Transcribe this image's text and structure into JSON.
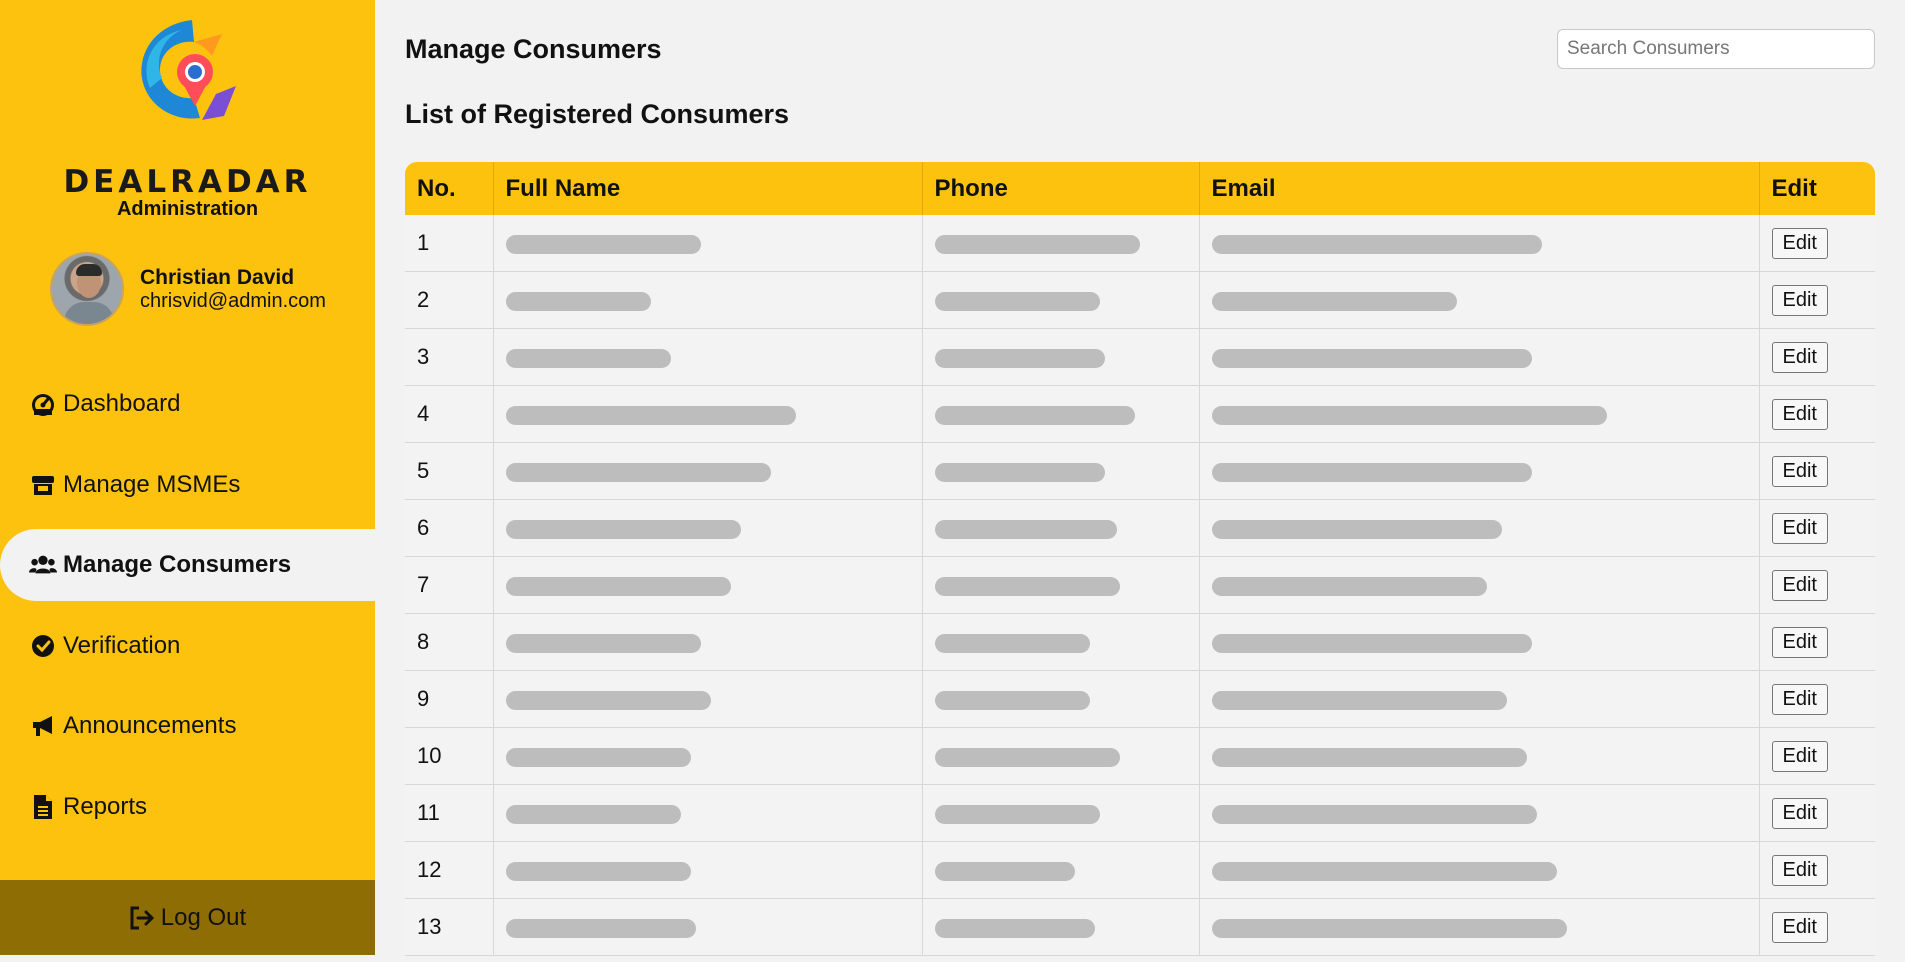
{
  "sidebar": {
    "brand": "DEALRADAR",
    "brand_sub": "Administration",
    "user": {
      "name": "Christian David",
      "email": "chrisvid@admin.com"
    },
    "nav": [
      {
        "label": "Dashboard",
        "icon": "gauge-icon"
      },
      {
        "label": "Manage MSMEs",
        "icon": "store-icon"
      },
      {
        "label": "Manage Consumers",
        "icon": "users-icon",
        "active": true
      },
      {
        "label": "Verification",
        "icon": "check-circle-icon"
      },
      {
        "label": "Announcements",
        "icon": "megaphone-icon"
      },
      {
        "label": "Reports",
        "icon": "file-icon"
      }
    ],
    "logout": "Log Out"
  },
  "main": {
    "title": "Manage Consumers",
    "search_placeholder": "Search Consumers",
    "list_title": "List of Registered Consumers",
    "columns": [
      "No.",
      "Full Name",
      "Phone",
      "Email",
      "Edit"
    ],
    "edit_label": "Edit",
    "rows": [
      "1",
      "2",
      "3",
      "4",
      "5",
      "6",
      "7",
      "8",
      "9",
      "10",
      "11",
      "12",
      "13"
    ]
  },
  "colors": {
    "accent": "#fdc20d",
    "logout_bg": "#8f6d05",
    "background": "#f2f2f2"
  }
}
